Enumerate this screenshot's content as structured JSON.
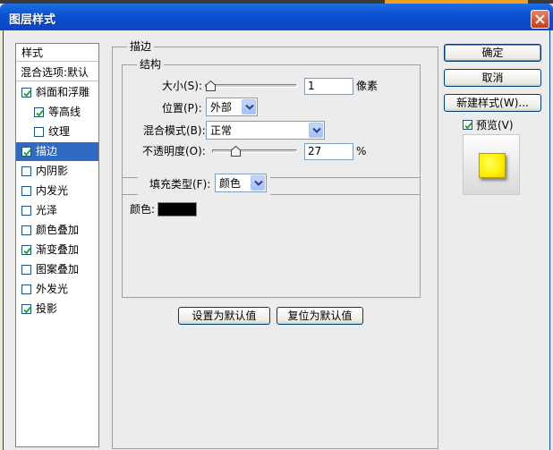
{
  "window": {
    "title": "图层样式"
  },
  "sidebar": {
    "header": "样式",
    "blend_options": "混合选项:默认",
    "items": [
      {
        "label": "斜面和浮雕",
        "checked": true,
        "selected": false,
        "indent": false
      },
      {
        "label": "等高线",
        "checked": true,
        "selected": false,
        "indent": true
      },
      {
        "label": "纹理",
        "checked": false,
        "selected": false,
        "indent": true
      },
      {
        "label": "描边",
        "checked": true,
        "selected": true,
        "indent": false
      },
      {
        "label": "内阴影",
        "checked": false,
        "selected": false,
        "indent": false
      },
      {
        "label": "内发光",
        "checked": false,
        "selected": false,
        "indent": false
      },
      {
        "label": "光泽",
        "checked": false,
        "selected": false,
        "indent": false
      },
      {
        "label": "颜色叠加",
        "checked": false,
        "selected": false,
        "indent": false
      },
      {
        "label": "渐变叠加",
        "checked": true,
        "selected": false,
        "indent": false
      },
      {
        "label": "图案叠加",
        "checked": false,
        "selected": false,
        "indent": false
      },
      {
        "label": "外发光",
        "checked": false,
        "selected": false,
        "indent": false
      },
      {
        "label": "投影",
        "checked": true,
        "selected": false,
        "indent": false
      }
    ]
  },
  "stroke": {
    "title": "描边",
    "structure": {
      "title": "结构",
      "size_label": "大小(S):",
      "size_value": "1",
      "size_unit": "像素",
      "size_slider_fraction": 0.0,
      "position_label": "位置(P):",
      "position_value": "外部",
      "blend_label": "混合模式(B):",
      "blend_value": "正常",
      "opacity_label": "不透明度(O):",
      "opacity_value": "27",
      "opacity_unit": "%",
      "opacity_slider_fraction": 0.27
    },
    "fill": {
      "type_label": "填充类型(F):",
      "type_value": "颜色",
      "color_label": "颜色:",
      "color": "#000000"
    },
    "set_default_button": "设置为默认值",
    "reset_default_button": "复位为默认值"
  },
  "actions": {
    "ok": "确定",
    "cancel": "取消",
    "new_style": "新建样式(W)...",
    "preview_label": "预览(V)",
    "preview_checked": true
  },
  "colors": {
    "titlebar": "#0a4fd0",
    "selection": "#316AC5",
    "preview_swatch": "#FFEE00"
  }
}
